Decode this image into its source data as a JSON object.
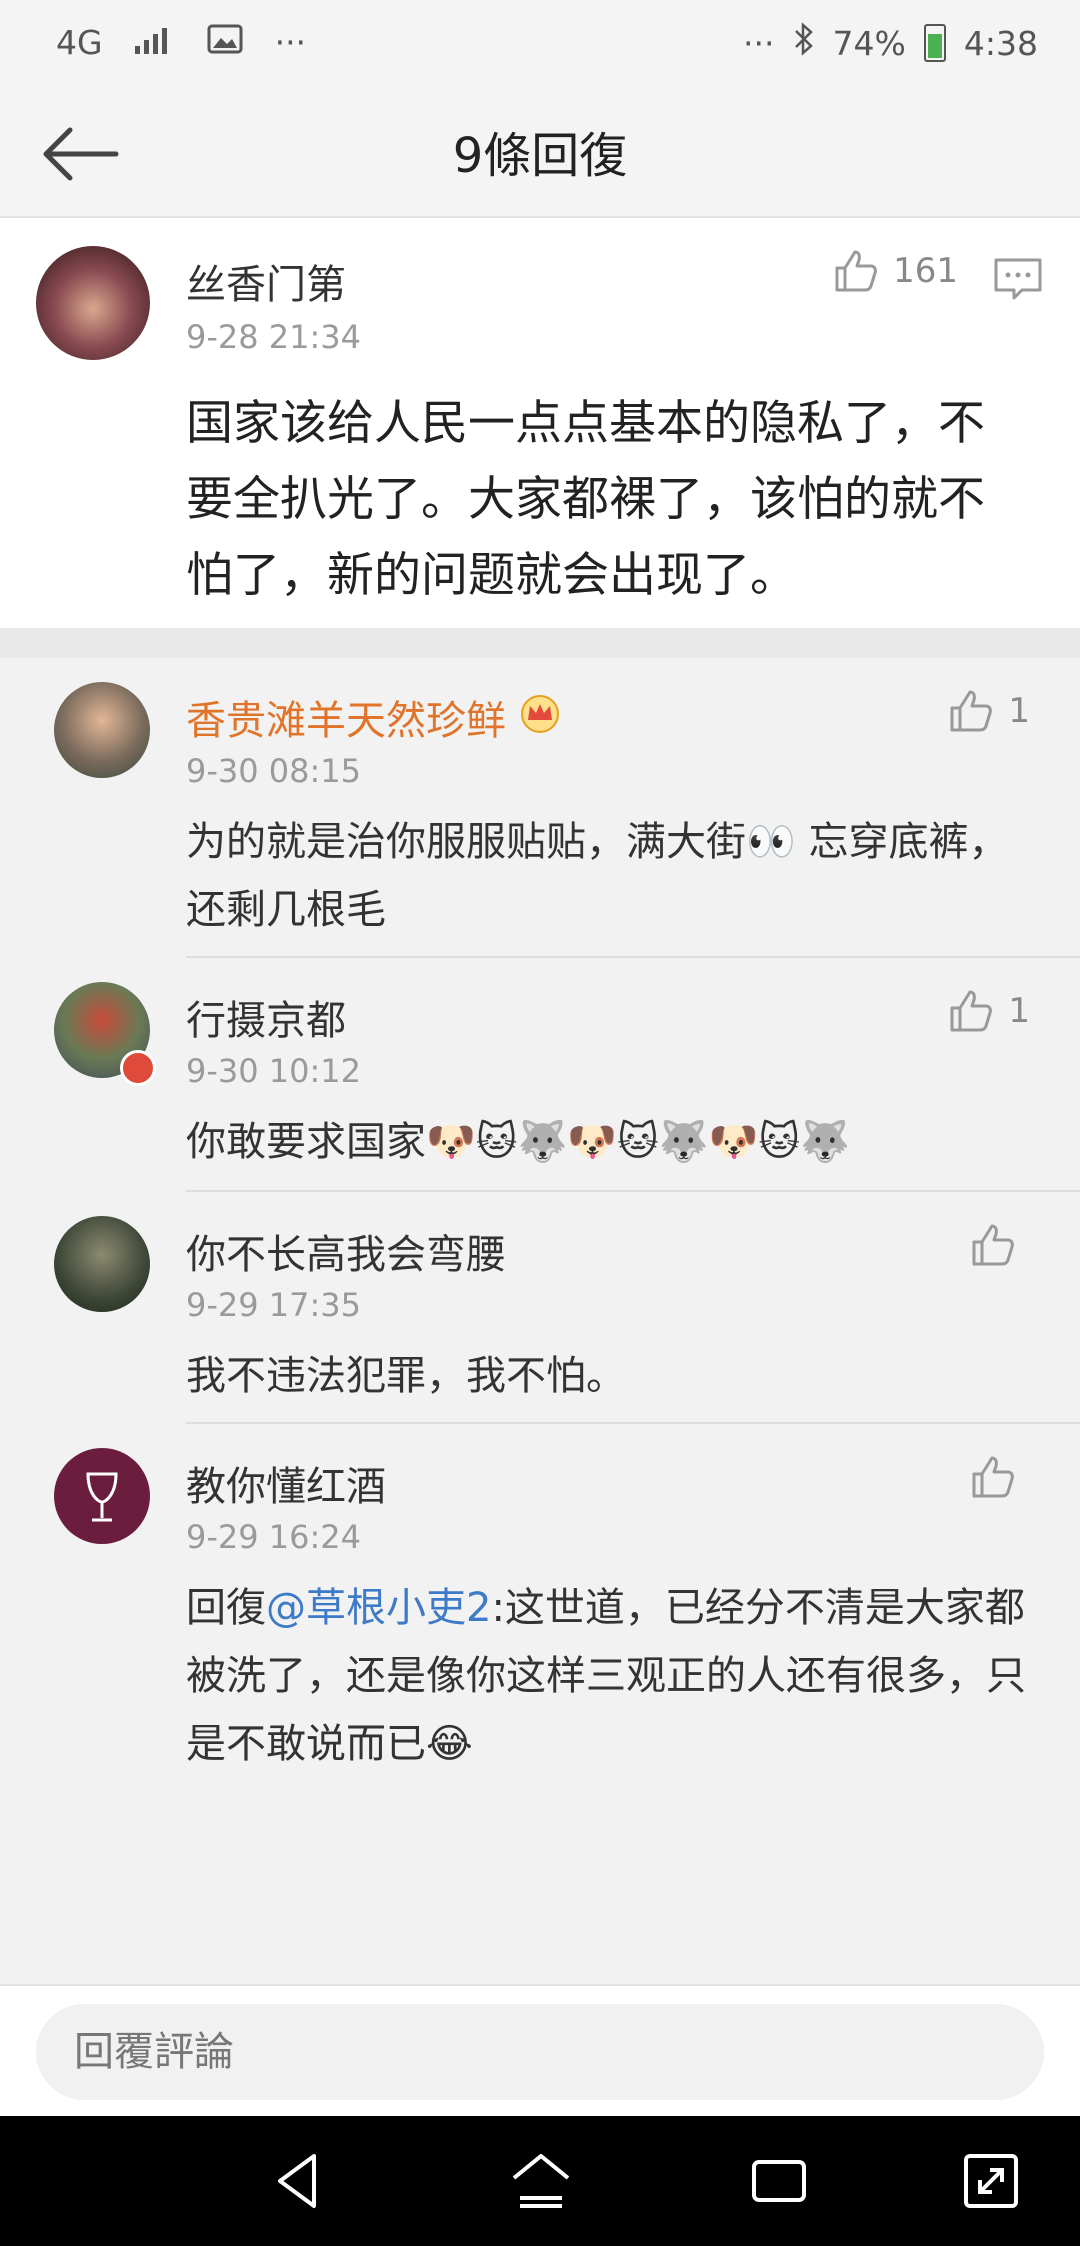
{
  "status_bar": {
    "network": "4G",
    "more_left": "···",
    "more_right": "···",
    "battery": "74%",
    "time": "4:38"
  },
  "header": {
    "title": "9條回復"
  },
  "main_comment": {
    "user": "丝香门第",
    "time": "9-28 21:34",
    "likes": "161",
    "text": "国家该给人民一点点基本的隐私了，不要全扒光了。大家都裸了，该怕的就不怕了，新的问题就会出现了。"
  },
  "replies": [
    {
      "user": "香贵滩羊天然珍鲜",
      "time": "9-30 08:15",
      "likes": "1",
      "text": "为的就是治你服服贴贴，满大街👀 忘穿底裤，还剩几根毛",
      "user_color": "#e0742a"
    },
    {
      "user": "行摄京都",
      "time": "9-30 10:12",
      "likes": "1",
      "text": "你敢要求国家🐶🐱🐺🐶🐱🐺🐶🐱🐺"
    },
    {
      "user": "你不长高我会弯腰",
      "time": "9-29 17:35",
      "likes": "",
      "text": "我不违法犯罪，我不怕。"
    },
    {
      "user": "教你懂红酒",
      "time": "9-29 16:24",
      "likes": "",
      "prefix": "回復",
      "mention": "@草根小吏2",
      "text": ":这世道，已经分不清是大家都被洗了，还是像你这样三观正的人还有很多，只是不敢说而已😂"
    }
  ],
  "input": {
    "placeholder": "回覆評論"
  },
  "colors": {
    "accent_link": "#3d7ac7",
    "vip_name": "#e0742a"
  }
}
